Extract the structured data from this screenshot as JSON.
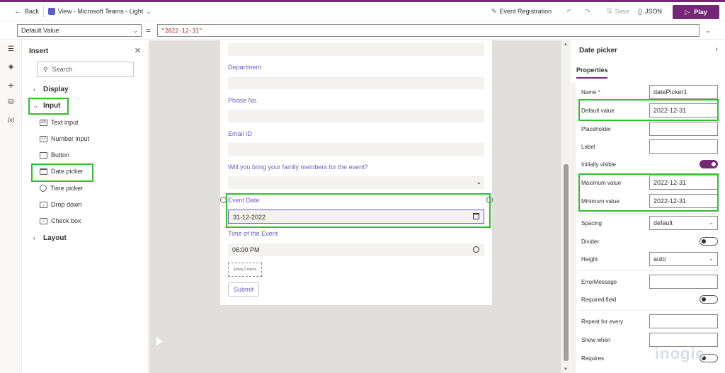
{
  "topbar": {
    "back_label": "Back",
    "view_label": "View - Microsoft Teams - Light",
    "app_name": "Event Registration",
    "save_label": "Save",
    "json_label": "JSON",
    "play_label": "Play",
    "accent_color": "#742774"
  },
  "formula": {
    "property": "Default Value",
    "equals": "=",
    "value": "\"2022-12-31\""
  },
  "rail": {
    "items": [
      "hamburger-icon",
      "layers-icon",
      "plus-icon",
      "database-icon",
      "variable-icon"
    ],
    "variable_text": "(x)"
  },
  "insert": {
    "title": "Insert",
    "search_placeholder": "Search",
    "categories": {
      "display": "Display",
      "input": "Input",
      "layout": "Layout"
    },
    "items": [
      "Text input",
      "Number input",
      "Button",
      "Date picker",
      "Time picker",
      "Drop down",
      "Check box"
    ]
  },
  "form": {
    "department_label": "Department",
    "phone_label": "Phone No.",
    "email_label": "Email ID",
    "family_label": "Will you bring your family members for the event?",
    "event_date_label": "Event Date",
    "event_date_value": "31-12-2022",
    "event_time_label": "Time of the Event",
    "event_time_value": "06:00 PM",
    "empty_column_label": "Empty Column",
    "submit_label": "Submit"
  },
  "properties": {
    "title": "Date picker",
    "tab": "Properties",
    "name_label": "Name",
    "name_required": "*",
    "name_value": "datePicker1",
    "default_value_label": "Default value",
    "default_value": "2022-12-31",
    "placeholder_label": "Placeholder",
    "label_label": "Label",
    "initially_visible_label": "Initially visible",
    "max_value_label": "Maximum value",
    "max_value": "2022-12-31",
    "min_value_label": "Minimum value",
    "min_value": "2022-12-31",
    "spacing_label": "Spacing",
    "spacing_value": "default",
    "divider_label": "Divider",
    "height_label": "Height",
    "height_value": "auto",
    "error_message_label": "ErrorMessage",
    "required_field_label": "Required field",
    "repeat_label": "Repeat for every",
    "show_when_label": "Show when",
    "requires_label": "Requires",
    "watermark": "inogic"
  },
  "highlight_color": "#2bc22b"
}
